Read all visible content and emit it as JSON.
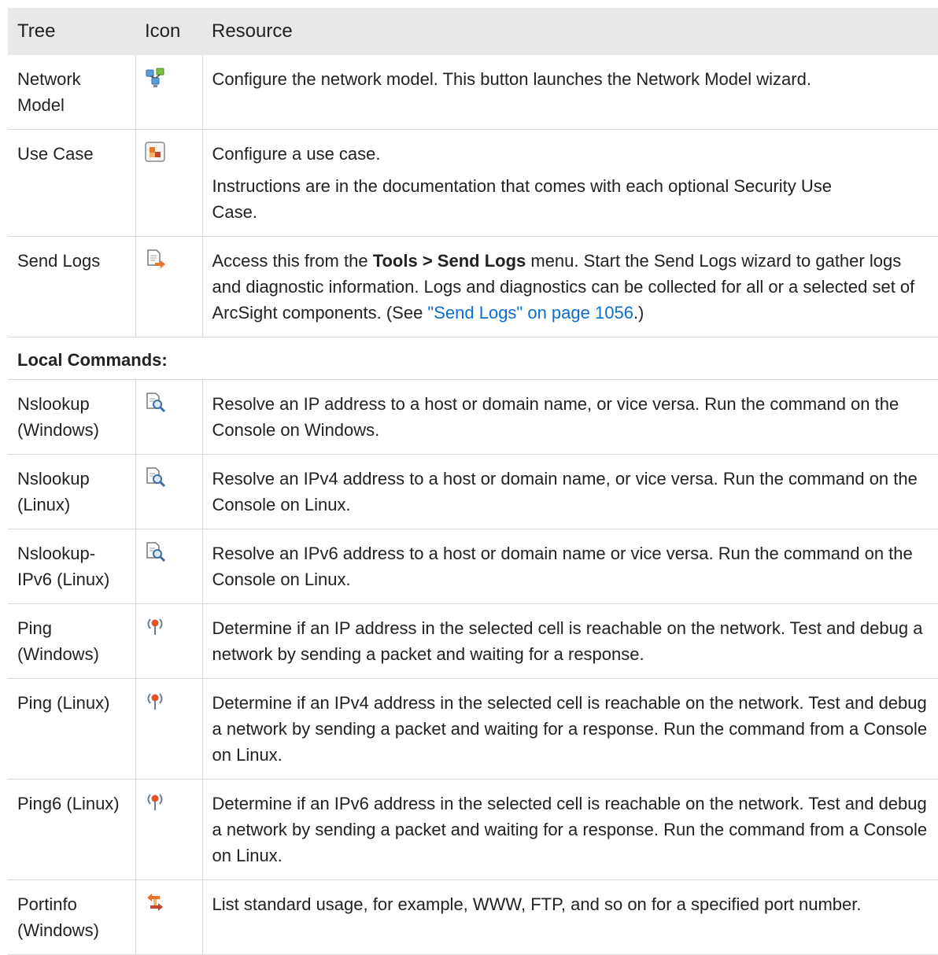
{
  "header": {
    "col1": "Tree",
    "col2": "Icon",
    "col3": "Resource"
  },
  "rows_top": [
    {
      "tree": "Network Model",
      "icon": "network-model-icon",
      "text": "Configure the network model. This button launches the Network Model wizard."
    },
    {
      "tree": "Use Case",
      "icon": "use-case-icon",
      "text": "Configure a use case.",
      "text2a": "Instructions are in the documentation that comes with each optional Security Use",
      "text2b": "Case."
    },
    {
      "tree": "Send Logs",
      "icon": "send-logs-icon",
      "text_pre": "Access this from the ",
      "text_bold": "Tools > Send Logs",
      "text_post": " menu. Start the Send Logs wizard to gather logs and diagnostic information. Logs and diagnostics can be collected for all or a selected set of ArcSight components. (See ",
      "link": "\"Send Logs\" on page 1056",
      "text_end": ".)"
    }
  ],
  "section_label": "Local Commands:",
  "rows_local": [
    {
      "tree": "Nslookup (Windows)",
      "icon": "nslookup-icon",
      "text": "Resolve an IP address to a host or domain name, or vice versa. Run the command on the Console on Windows."
    },
    {
      "tree": "Nslookup (Linux)",
      "icon": "nslookup-icon",
      "text": "Resolve an IPv4 address to a host or domain name, or vice versa. Run the command on the Console on Linux."
    },
    {
      "tree": "Nslookup-IPv6 (Linux)",
      "icon": "nslookup-icon",
      "text": "Resolve an IPv6 address to a host or domain name or vice versa. Run the command on the Console on Linux."
    },
    {
      "tree": "Ping (Windows)",
      "icon": "ping-icon",
      "text": "Determine if an IP address in the selected cell is reachable on the network. Test and debug a network by sending a packet and waiting for a response."
    },
    {
      "tree": "Ping (Linux)",
      "icon": "ping-icon",
      "text": "Determine if an IPv4 address in the selected cell is reachable on the network. Test and debug a network by sending a packet and waiting for a response. Run the command from a Console on Linux."
    },
    {
      "tree": "Ping6 (Linux)",
      "icon": "ping-icon",
      "text": "Determine if an IPv6 address in the selected cell is reachable on the network. Test and debug a network by sending a packet and waiting for a response. Run the command from a Console on Linux."
    },
    {
      "tree": "Portinfo (Windows)",
      "icon": "portinfo-icon",
      "text": "List standard usage, for example, WWW, FTP, and so on for a specified port number."
    }
  ]
}
